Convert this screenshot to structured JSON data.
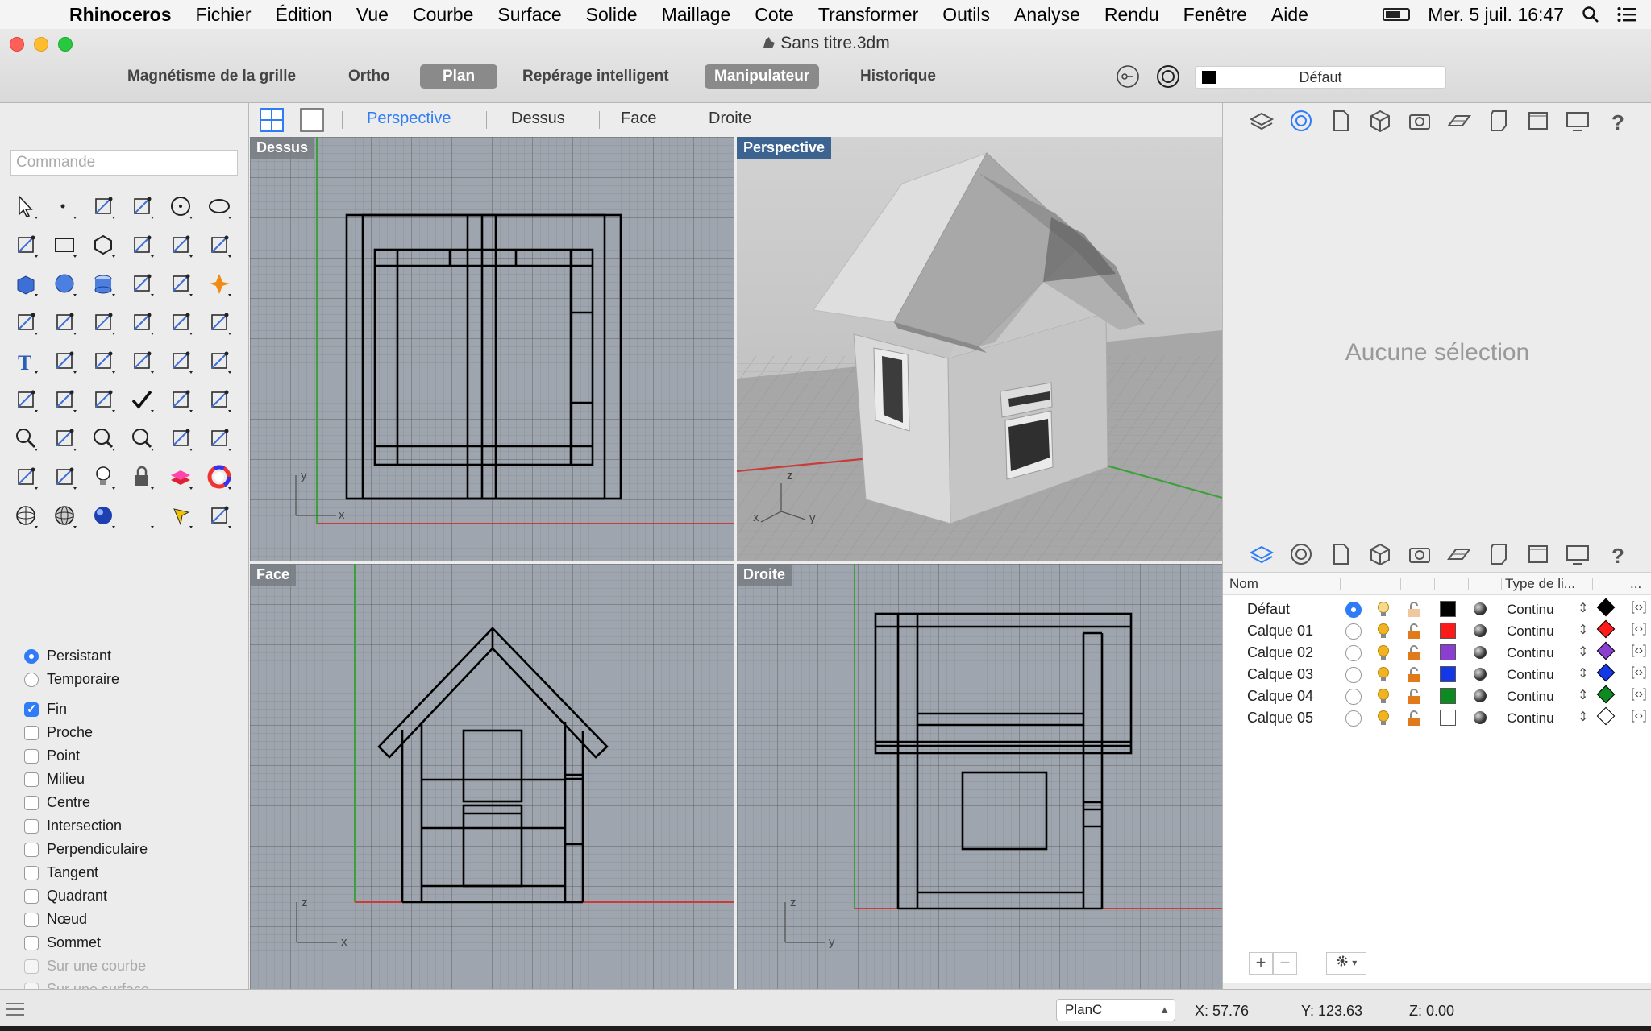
{
  "menubar": {
    "app": "Rhinoceros",
    "items": [
      "Fichier",
      "Édition",
      "Vue",
      "Courbe",
      "Surface",
      "Solide",
      "Maillage",
      "Cote",
      "Transformer",
      "Outils",
      "Analyse",
      "Rendu",
      "Fenêtre",
      "Aide"
    ],
    "clock": "Mer. 5 juil.  16:47"
  },
  "window": {
    "title": "Sans titre.3dm"
  },
  "toolbar": {
    "grid_snap": "Magnétisme de la grille",
    "ortho": "Ortho",
    "planar": "Plan",
    "smart_track": "Repérage intelligent",
    "gumball": "Manipulateur",
    "history": "Historique",
    "current_layer": "Défaut"
  },
  "command": {
    "placeholder": "Commande"
  },
  "view_tabs": [
    "Perspective",
    "Dessus",
    "Face",
    "Droite"
  ],
  "viewports": {
    "top": "Dessus",
    "perspective": "Perspective",
    "front": "Face",
    "right": "Droite"
  },
  "osnap": {
    "persistent": "Persistant",
    "temporary": "Temporaire",
    "items": [
      {
        "label": "Fin",
        "checked": true,
        "enabled": true
      },
      {
        "label": "Proche",
        "checked": false,
        "enabled": true
      },
      {
        "label": "Point",
        "checked": false,
        "enabled": true
      },
      {
        "label": "Milieu",
        "checked": false,
        "enabled": true
      },
      {
        "label": "Centre",
        "checked": false,
        "enabled": true
      },
      {
        "label": "Intersection",
        "checked": false,
        "enabled": true
      },
      {
        "label": "Perpendiculaire",
        "checked": false,
        "enabled": true
      },
      {
        "label": "Tangent",
        "checked": false,
        "enabled": true
      },
      {
        "label": "Quadrant",
        "checked": false,
        "enabled": true
      },
      {
        "label": "Nœud",
        "checked": false,
        "enabled": true
      },
      {
        "label": "Sommet",
        "checked": false,
        "enabled": true
      },
      {
        "label": "Sur une courbe",
        "checked": false,
        "enabled": false
      },
      {
        "label": "Sur une surface",
        "checked": false,
        "enabled": false
      }
    ]
  },
  "properties": {
    "empty": "Aucune sélection"
  },
  "layers": {
    "header": {
      "name": "Nom",
      "linetype": "Type de li...",
      "more": "..."
    },
    "rows": [
      {
        "name": "Défaut",
        "current": true,
        "color": "#000000",
        "linetype": "Continu"
      },
      {
        "name": "Calque 01",
        "current": false,
        "color": "#ff1a1a",
        "linetype": "Continu"
      },
      {
        "name": "Calque 02",
        "current": false,
        "color": "#8a3fd1",
        "linetype": "Continu"
      },
      {
        "name": "Calque 03",
        "current": false,
        "color": "#1438e8",
        "linetype": "Continu"
      },
      {
        "name": "Calque 04",
        "current": false,
        "color": "#0e8a22",
        "linetype": "Continu"
      },
      {
        "name": "Calque 05",
        "current": false,
        "color": "#ffffff",
        "linetype": "Continu"
      }
    ]
  },
  "status": {
    "cplane": "PlanC",
    "x": "X: 57.76",
    "y": "Y: 123.63",
    "z": "Z: 0.00"
  },
  "colors": {
    "accent": "#2f7cf6",
    "active_viewport": "#3d6391",
    "x_axis": "#c83c3c",
    "y_axis": "#3ca03c"
  }
}
